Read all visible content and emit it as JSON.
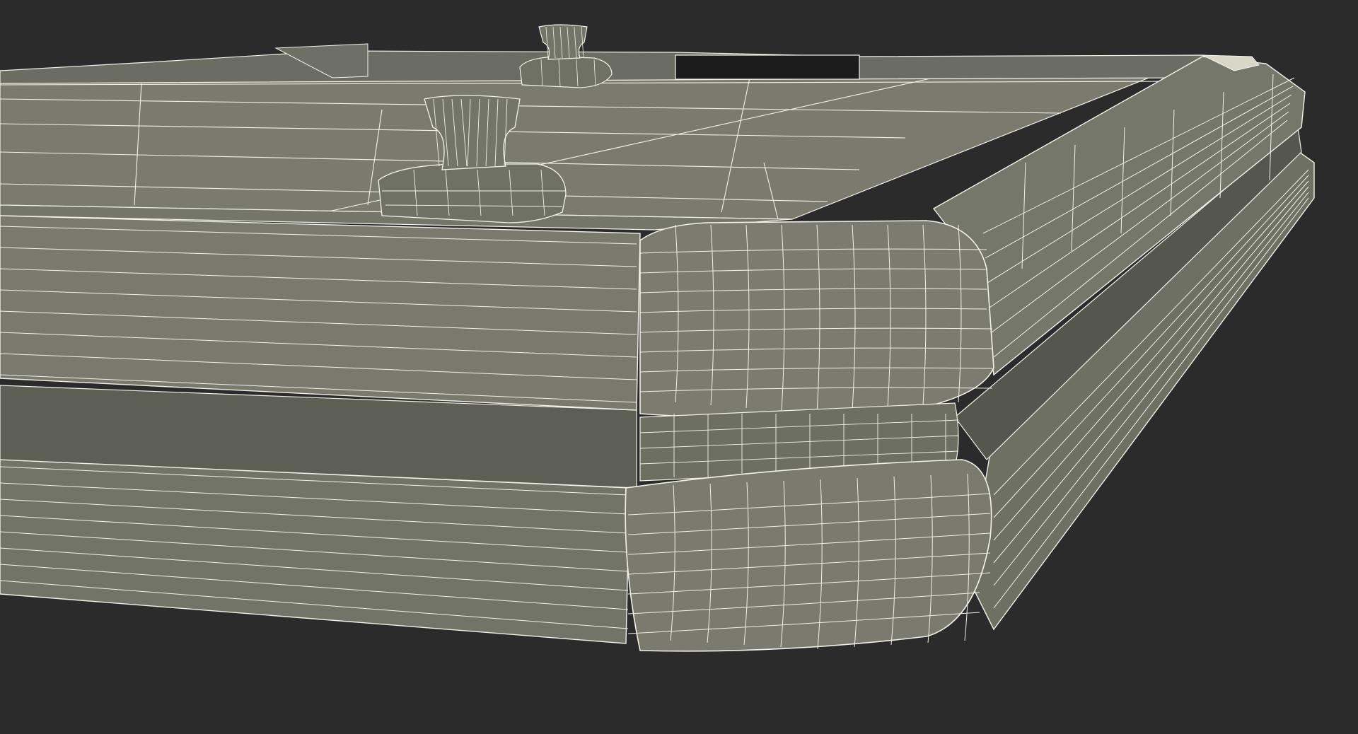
{
  "scene": {
    "subject": "air-hockey-table-wireframe",
    "colors": {
      "background": "#2b2b2b",
      "surface": "#7a7b6e",
      "surface_dark": "#6a6b5f",
      "shadow": "#4e4f46",
      "slot": "#1c1c1c",
      "wire": "#f2f2ea"
    },
    "objects": [
      "table-top",
      "corner-bumper",
      "lower-frame",
      "mallet",
      "goal-slot"
    ]
  }
}
